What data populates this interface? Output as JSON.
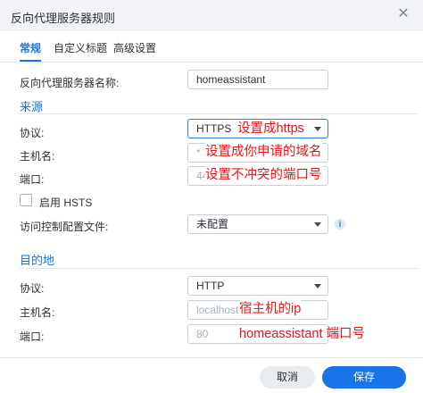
{
  "dialog": {
    "title": "反向代理服务器规则",
    "close_glyph": "✕"
  },
  "tabs": [
    {
      "label": "常规",
      "active": true
    },
    {
      "label": "自定义标题",
      "active": false
    },
    {
      "label": "高级设置",
      "active": false
    }
  ],
  "rule_name": {
    "label": "反向代理服务器名称:",
    "value": "homeassistant"
  },
  "source": {
    "heading": "来源",
    "protocol": {
      "label": "协议:",
      "value": "HTTPS"
    },
    "hostname": {
      "label": "主机名:",
      "value": "*"
    },
    "port": {
      "label": "端口:",
      "value": "44"
    },
    "hsts": {
      "label": "启用 HSTS",
      "checked": false
    },
    "access_profile": {
      "label": "访问控制配置文件:",
      "value": "未配置"
    }
  },
  "destination": {
    "heading": "目的地",
    "protocol": {
      "label": "协议:",
      "value": "HTTP"
    },
    "hostname": {
      "label": "主机名:",
      "placeholder": "localhost"
    },
    "port": {
      "label": "端口:",
      "placeholder": "80"
    }
  },
  "annotations": {
    "protocol_note": "设置成https",
    "hostname_note": "设置成你申请的域名",
    "port_note": "设置不冲突的端口号",
    "dest_host_note": "宿主机的ip",
    "dest_port_note": "homeassistant 端口号"
  },
  "footer": {
    "cancel_label": "取消",
    "save_label": "保存"
  },
  "colors": {
    "accent": "#1a73e8",
    "annotation": "#e8151a"
  },
  "icons": {
    "close": "close-icon",
    "dropdown": "chevron-down-icon",
    "info": "info-icon"
  }
}
